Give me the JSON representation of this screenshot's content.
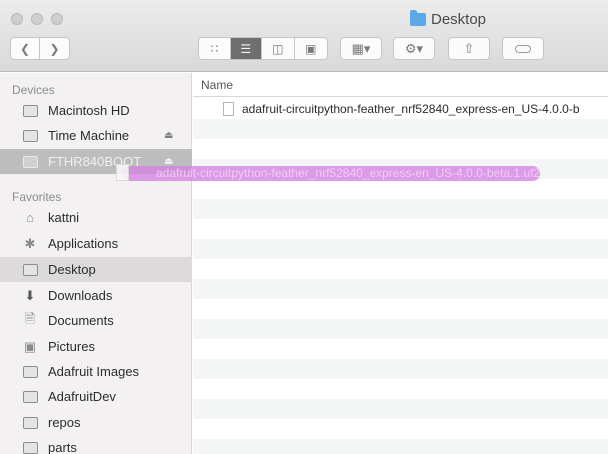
{
  "window": {
    "title": "Desktop"
  },
  "toolbar": {
    "back_icon": "chevron-left",
    "forward_icon": "chevron-right",
    "view_modes": [
      "icon-view",
      "list-view",
      "column-view",
      "cover-flow-view"
    ],
    "arrange_icon": "grid-arrange",
    "action_icon": "gear",
    "share_icon": "share",
    "tags_icon": "tag"
  },
  "sidebar": {
    "devices_label": "Devices",
    "devices": [
      {
        "label": "Macintosh HD",
        "icon": "hard-drive"
      },
      {
        "label": "Time Machine",
        "icon": "time-machine-drive",
        "eject": "⏏"
      },
      {
        "label": "FTHR840BOOT",
        "icon": "external-drive",
        "eject": "⏏"
      }
    ],
    "favorites_label": "Favorites",
    "favorites": [
      {
        "label": "kattni",
        "icon": "home"
      },
      {
        "label": "Applications",
        "icon": "applications"
      },
      {
        "label": "Desktop",
        "icon": "desktop"
      },
      {
        "label": "Downloads",
        "icon": "downloads"
      },
      {
        "label": "Documents",
        "icon": "documents"
      },
      {
        "label": "Pictures",
        "icon": "camera"
      },
      {
        "label": "Adafruit Images",
        "icon": "folder"
      },
      {
        "label": "AdafruitDev",
        "icon": "folder"
      },
      {
        "label": "repos",
        "icon": "folder"
      },
      {
        "label": "parts",
        "icon": "folder"
      }
    ]
  },
  "content": {
    "column_name": "Name",
    "files": [
      {
        "name": "adafruit-circuitpython-feather_nrf52840_express-en_US-4.0.0-b"
      }
    ],
    "drag_label": "adafruit-circuitpython-feather_nrf52840_express-en_US-4.0.0-beta.1.uf2"
  },
  "colors": {
    "drag_highlight": "#d582e2",
    "folder_accent": "#5aa8e8"
  }
}
